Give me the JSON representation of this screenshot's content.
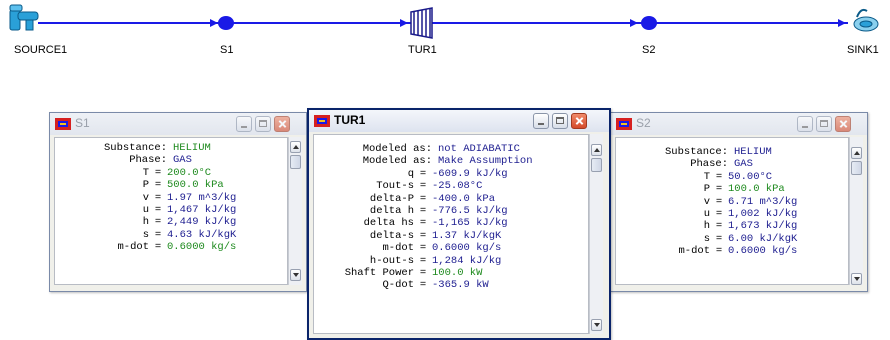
{
  "flow": {
    "nodes": [
      {
        "id": "source",
        "label": "SOURCE1",
        "icon": "faucet-icon"
      },
      {
        "id": "s1",
        "label": "S1",
        "icon": "state-point-icon"
      },
      {
        "id": "tur1",
        "label": "TUR1",
        "icon": "turbine-icon"
      },
      {
        "id": "s2",
        "label": "S2",
        "icon": "state-point-icon"
      },
      {
        "id": "sink",
        "label": "SINK1",
        "icon": "sink-icon"
      }
    ],
    "colors": {
      "line": "#1a1ae6",
      "node": "#1a1ae6",
      "turbine": "#1a1a8a",
      "source": "#2aa0d8"
    }
  },
  "windows": {
    "s1": {
      "title": "S1",
      "rows": [
        {
          "k": "Substance:",
          "v": "HELIUM",
          "color": "green"
        },
        {
          "k": "Phase:",
          "v": "GAS",
          "color": "blue"
        },
        {
          "k": "T",
          "v": "200.0°C",
          "color": "green"
        },
        {
          "k": "P",
          "v": "500.0 kPa",
          "color": "green"
        },
        {
          "k": "v",
          "v": "1.97 m^3/kg",
          "color": "blue"
        },
        {
          "k": "u",
          "v": "1,467 kJ/kg",
          "color": "blue"
        },
        {
          "k": "h",
          "v": "2,449 kJ/kg",
          "color": "blue"
        },
        {
          "k": "s",
          "v": "4.63 kJ/kgK",
          "color": "blue"
        },
        {
          "k": "m-dot",
          "v": "0.6000 kg/s",
          "color": "green"
        }
      ]
    },
    "tur1": {
      "title": "TUR1",
      "rows": [
        {
          "k": "Modeled as:",
          "v": "not ADIABATIC",
          "color": "blue"
        },
        {
          "k": "Modeled as:",
          "v": "Make Assumption",
          "color": "blue"
        },
        {
          "k": "q",
          "v": "-609.9 kJ/kg",
          "color": "blue"
        },
        {
          "k": "Tout-s",
          "v": "-25.08°C",
          "color": "blue"
        },
        {
          "k": "delta-P",
          "v": "-400.0 kPa",
          "color": "blue"
        },
        {
          "k": "delta h",
          "v": "-776.5 kJ/kg",
          "color": "blue"
        },
        {
          "k": "delta hs",
          "v": "-1,165 kJ/kg",
          "color": "blue"
        },
        {
          "k": "delta-s",
          "v": "1.37 kJ/kgK",
          "color": "blue"
        },
        {
          "k": "m-dot",
          "v": "0.6000 kg/s",
          "color": "blue"
        },
        {
          "k": "h-out-s",
          "v": "1,284 kJ/kg",
          "color": "blue"
        },
        {
          "k": "Shaft Power",
          "v": "100.0 kW",
          "color": "green"
        },
        {
          "k": "Q-dot",
          "v": "-365.9 kW",
          "color": "blue"
        }
      ]
    },
    "s2": {
      "title": "S2",
      "rows": [
        {
          "k": "Substance:",
          "v": "HELIUM",
          "color": "blue"
        },
        {
          "k": "Phase:",
          "v": "GAS",
          "color": "blue"
        },
        {
          "k": "T",
          "v": "50.00°C",
          "color": "blue"
        },
        {
          "k": "P",
          "v": "100.0 kPa",
          "color": "green"
        },
        {
          "k": "v",
          "v": "6.71 m^3/kg",
          "color": "blue"
        },
        {
          "k": "u",
          "v": "1,002 kJ/kg",
          "color": "blue"
        },
        {
          "k": "h",
          "v": "1,673 kJ/kg",
          "color": "blue"
        },
        {
          "k": "s",
          "v": "6.00 kJ/kgK",
          "color": "blue"
        },
        {
          "k": "m-dot",
          "v": "0.6000 kg/s",
          "color": "blue"
        }
      ]
    }
  }
}
